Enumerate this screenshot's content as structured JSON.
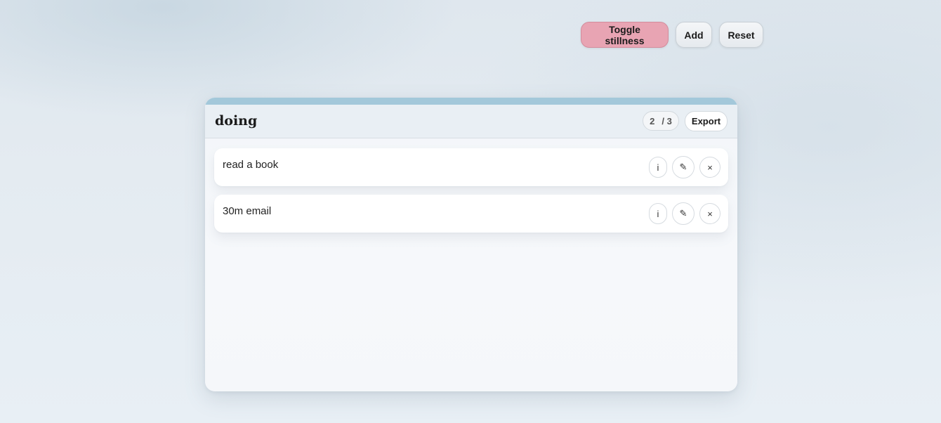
{
  "toolbar": {
    "toggle_label": "Toggle stillness",
    "add_label": "Add",
    "reset_label": "Reset",
    "accent_color": "#e8a4b3"
  },
  "panel": {
    "title": "doing",
    "count_current": "2",
    "count_total": "/ 3",
    "export_label": "Export",
    "topbar_color": "#a3c8da",
    "items": [
      {
        "text": "read a book",
        "info_icon": "i",
        "edit_icon": "✎",
        "remove_icon": "×"
      },
      {
        "text": "30m email",
        "info_icon": "i",
        "edit_icon": "✎",
        "remove_icon": "×"
      }
    ]
  }
}
